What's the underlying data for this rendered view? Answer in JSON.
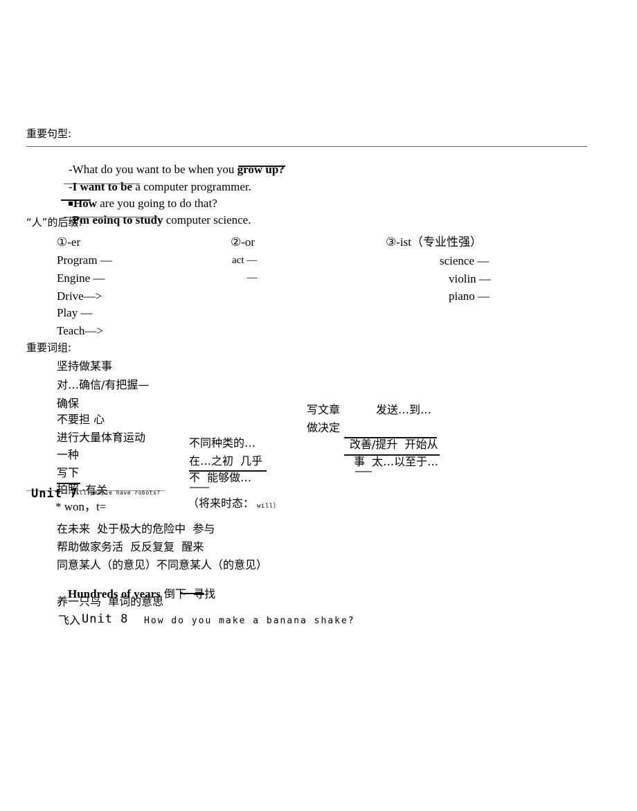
{
  "document": {
    "type": "scanned-study-notes",
    "background_color": "#ffffff",
    "text_color": "#000000",
    "rule_color": "#6b6b6b"
  },
  "sections": {
    "sentence_patterns": {
      "heading": "重要句型:",
      "lines": [
        {
          "prefix": "-",
          "plain1": "What do you want to be when you ",
          "bold": "grow up?",
          "plain2": ""
        },
        {
          "prefix": "-",
          "bold": "I want to be",
          "plain2": " a computer programmer."
        },
        {
          "prefix": "■",
          "bold": "How",
          "plain2": " are you going to do that?"
        },
        {
          "prefix": "-",
          "bold": "Pm eoinq to study",
          "plain2": " computer science."
        }
      ]
    },
    "person_suffixes": {
      "heading": "“人”的后缀:",
      "columns": [
        {
          "label": "①-er",
          "items": [
            "Program —",
            "Engine —",
            "Drive—>",
            "Play —",
            "Teach—>"
          ]
        },
        {
          "label": "②-or",
          "items": [
            "act —",
            "—"
          ]
        },
        {
          "label": "③-ist（专业性强）",
          "items": [
            "science —",
            "violin —",
            "piano —"
          ]
        }
      ]
    },
    "key_phrases": {
      "heading": "重要词组:",
      "column_left": [
        "坚持做某事",
        "对…确信/有把握—",
        "确保",
        "不要担 心",
        "进行大量体育运动",
        "一种",
        "写下",
        "拍照",
        "·有关"
      ],
      "column_mid": [
        "不同种类的…",
        "在…之初  几乎",
        "不  能够做…"
      ],
      "column_right": [
        "写文章",
        "发送…到…",
        "做决定",
        "改善/提升  开始从",
        "事  太…以至于…"
      ]
    },
    "unit7": {
      "label": "Unit 7",
      "subtitle": "Will people have robots?",
      "note_star": "* won，t=",
      "future_tense_note": "（将来时态：",
      "future_tense_word": "will）",
      "lines": [
        "在未来  处于极大的危险中  参与",
        "帮助做家务活  反反复复  醒来",
        "同意某人（的意见）不同意某人（的意见）"
      ],
      "bold_line": {
        "bold": "Hundreds of years",
        "rest": " 倒下  寻找"
      },
      "after_lines": [
        "养一只鸟  单词的意思"
      ]
    },
    "unit8": {
      "prefix": "飞入",
      "label": "Unit 8",
      "subtitle": "How do you make a banana shake?"
    }
  }
}
